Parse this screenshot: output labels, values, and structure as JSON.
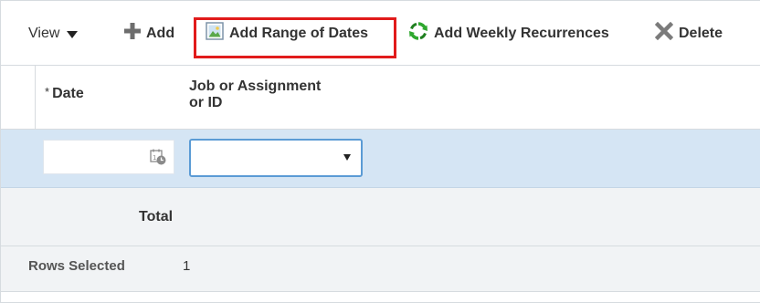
{
  "toolbar": {
    "view_label": "View",
    "add_label": "Add",
    "add_range_label": "Add Range of Dates",
    "weekly_label": "Add Weekly Recurrences",
    "delete_label": "Delete"
  },
  "table": {
    "columns": [
      {
        "required_marker": "*",
        "label": "Date"
      },
      {
        "label_line1": "Job or Assignment",
        "label_line2": "or ID"
      }
    ],
    "rows": [
      {
        "date": "",
        "job": ""
      }
    ],
    "total_label": "Total"
  },
  "footer": {
    "rows_selected_label": "Rows Selected",
    "rows_selected_value": "1"
  },
  "icons": {
    "add": "plus-icon",
    "add_range": "calendar-range-icon",
    "weekly": "recurrence-icon",
    "delete": "delete-x-icon",
    "date_picker": "calendar-clock-icon"
  },
  "colors": {
    "highlight": "#e11b1b",
    "selected_row": "#d5e5f4",
    "recurrence_green": "#2fa82f"
  }
}
